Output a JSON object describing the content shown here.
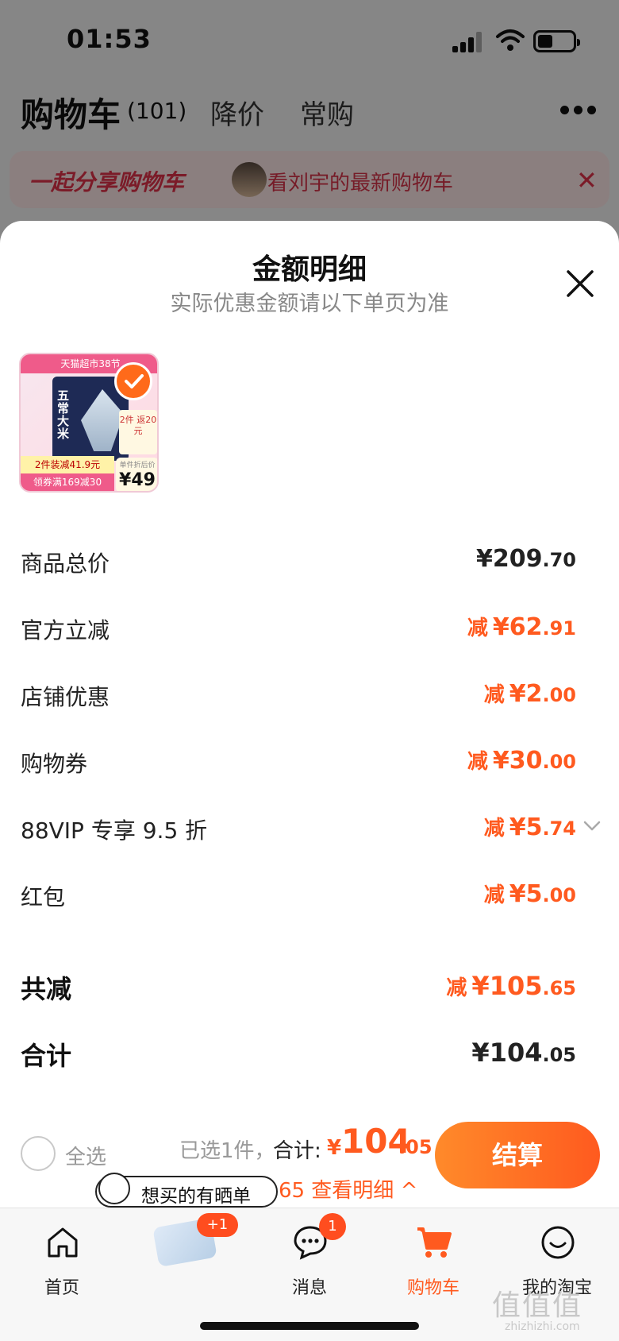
{
  "status_bar": {
    "time": "01:53"
  },
  "top_tabs": {
    "cart": "购物车",
    "cart_count": "(101)",
    "price_drop": "降价",
    "frequent": "常购"
  },
  "share_banner": {
    "title": "一起分享购物车",
    "text": "看刘宇的最新购物车",
    "close": "✕"
  },
  "sheet": {
    "title": "金额明细",
    "subtitle": "实际优惠金额请以下单页为准"
  },
  "product": {
    "banner": "天猫超市38节",
    "bag_text": "五常大米",
    "return_text": "2件 返20元",
    "promo1": "2件装减41.9元",
    "promo2": "领券满169减30",
    "price_label": "单件折后价",
    "price": "¥49"
  },
  "rows": [
    {
      "label": "商品总价",
      "prefix": "",
      "int": "¥209",
      "cents": ".70",
      "color": "black"
    },
    {
      "label": "官方立减",
      "prefix": "减",
      "int": "¥62",
      "cents": ".91",
      "color": "#ff5a1f"
    },
    {
      "label": "店铺优惠",
      "prefix": "减",
      "int": "¥2",
      "cents": ".00",
      "color": "#ff5a1f"
    },
    {
      "label": "购物券",
      "prefix": "减",
      "int": "¥30",
      "cents": ".00",
      "color": "#ff5a1f"
    },
    {
      "label": "88VIP 专享 9.5 折",
      "prefix": "减",
      "int": "¥5",
      "cents": ".74",
      "color": "#ff5a1f"
    },
    {
      "label": "红包",
      "prefix": "减",
      "int": "¥5",
      "cents": ".00",
      "color": "#ff5a1f"
    }
  ],
  "summary": {
    "total_discount_label": "共减",
    "total_discount_prefix": "减",
    "total_discount_int": "¥105",
    "total_discount_cents": ".65",
    "total_label": "合计",
    "total_int": "¥104",
    "total_cents": ".05"
  },
  "checkout": {
    "select_all": "全选",
    "selected": "已选1件，",
    "total_label": "合计:",
    "yen": "¥",
    "amount_int": "104",
    "amount_cents": ".05",
    "discount_line": "共减 ¥ 105.65  查看明细 ^",
    "button": "结算"
  },
  "bubble": {
    "text": "想买的有晒单"
  },
  "tabbar": {
    "home": "首页",
    "recommend_badge": "+1",
    "messages": "消息",
    "messages_badge": "1",
    "cart": "购物车",
    "mine": "我的淘宝"
  },
  "watermark": {
    "text": "值值值",
    "url": "zhizhizhi.com"
  },
  "colors": {
    "accent": "#ff5a1f",
    "banner_bg": "#fde8e8"
  }
}
